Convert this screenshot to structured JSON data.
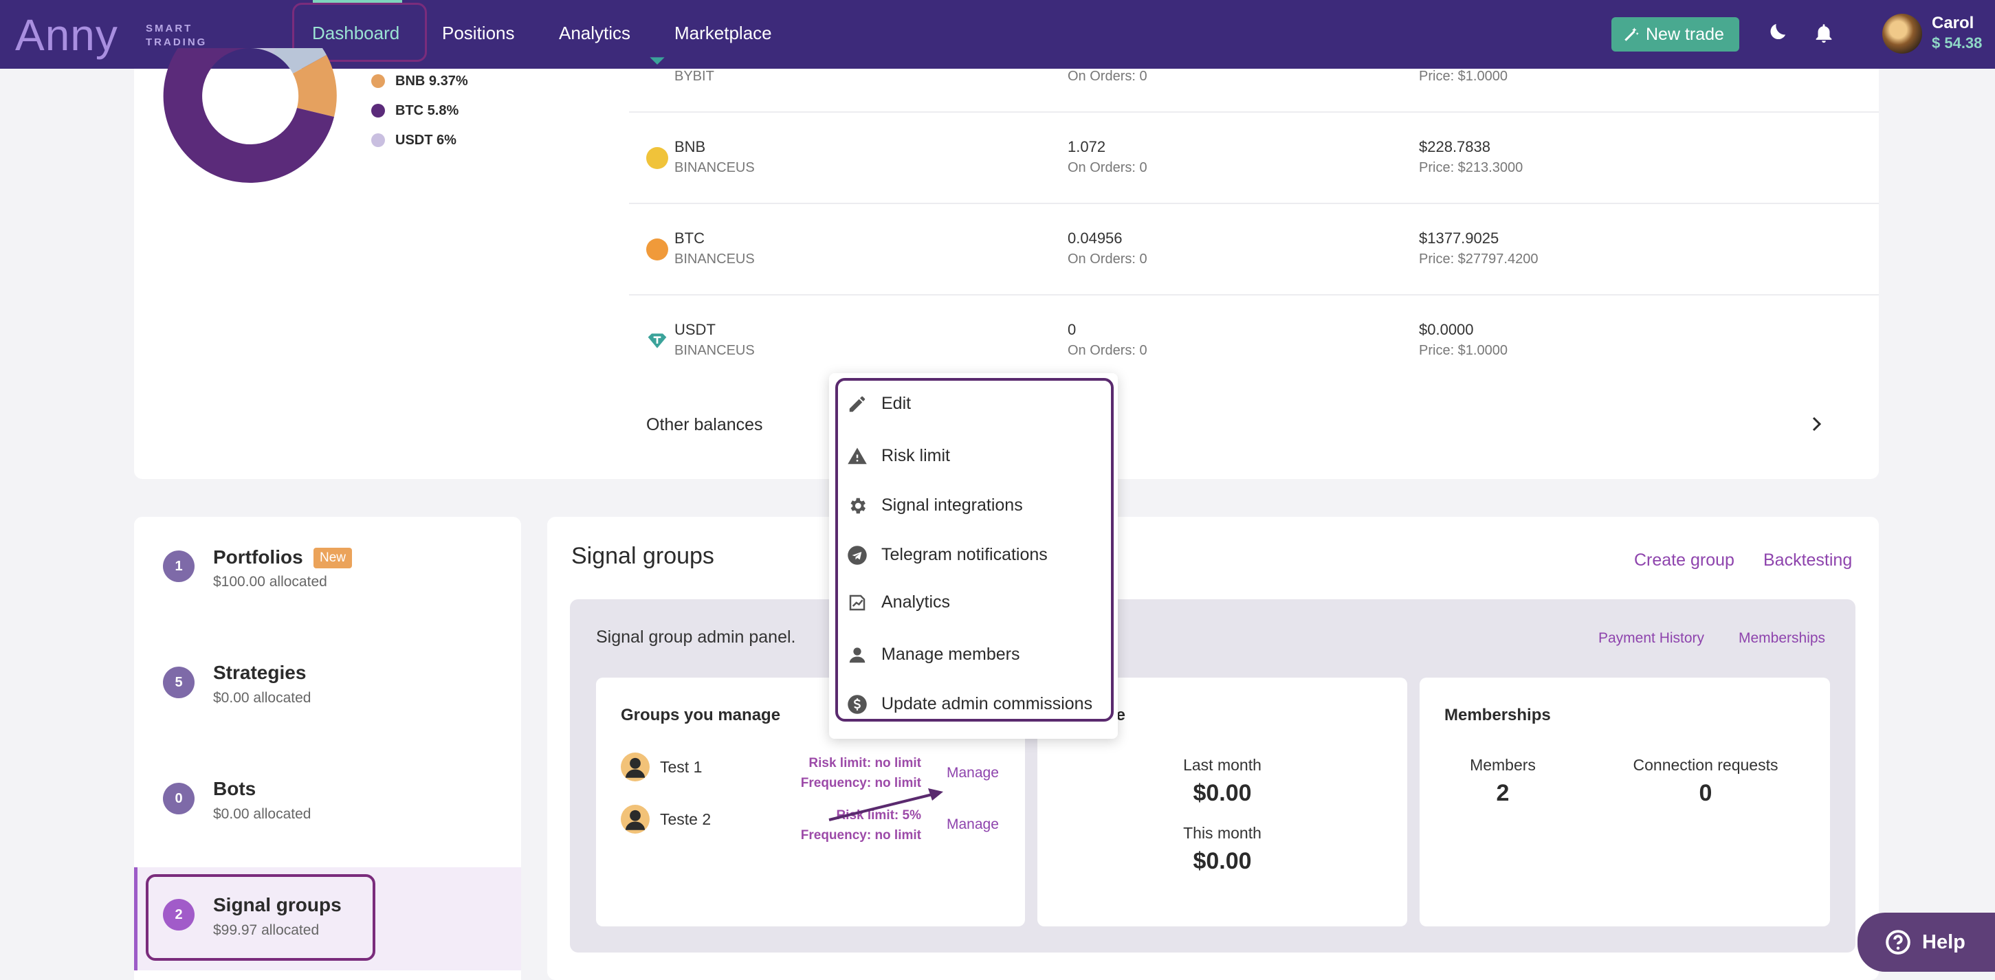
{
  "nav": {
    "logo_word": "Anny",
    "logo_sub_1": "SMART",
    "logo_sub_2": "TRADING",
    "items": [
      "Dashboard",
      "Positions",
      "Analytics",
      "Marketplace"
    ],
    "new_trade": "New trade",
    "user_name": "Carol",
    "user_balance": "$ 54.38"
  },
  "portfolio": {
    "legend": [
      {
        "label": "BNB 9.37%",
        "color": "#e5a15f"
      },
      {
        "label": "BTC 5.8%",
        "color": "#5b2b7a"
      },
      {
        "label": "USDT 6%",
        "color": "#c9bfe0"
      }
    ],
    "assets": [
      {
        "name": "",
        "exchange": "BYBIT",
        "amount": "",
        "on_orders": "On Orders: 0",
        "value": "",
        "price": "Price: $1.0000",
        "coin_color": "#3ba39a"
      },
      {
        "name": "BNB",
        "exchange": "BINANCEUS",
        "amount": "1.072",
        "on_orders": "On Orders: 0",
        "value": "$228.7838",
        "price": "Price: $213.3000",
        "coin_color": "#f0c33a"
      },
      {
        "name": "BTC",
        "exchange": "BINANCEUS",
        "amount": "0.04956",
        "on_orders": "On Orders: 0",
        "value": "$1377.9025",
        "price": "Price: $27797.4200",
        "coin_color": "#f09a3a"
      },
      {
        "name": "USDT",
        "exchange": "BINANCEUS",
        "amount": "0",
        "on_orders": "On Orders: 0",
        "value": "$0.0000",
        "price": "Price: $1.0000",
        "coin_color": "#3ba39a"
      }
    ],
    "other_balances": "Other balances"
  },
  "sidebar": {
    "items": [
      {
        "num": "1",
        "title": "Portfolios",
        "sub": "$100.00 allocated",
        "badge": "New"
      },
      {
        "num": "5",
        "title": "Strategies",
        "sub": "$0.00 allocated"
      },
      {
        "num": "0",
        "title": "Bots",
        "sub": "$0.00 allocated"
      },
      {
        "num": "2",
        "title": "Signal groups",
        "sub": "$99.97 allocated"
      }
    ]
  },
  "signal_groups": {
    "title": "Signal groups",
    "create_group": "Create group",
    "backtesting": "Backtesting",
    "panel_text": "Signal group admin panel.",
    "payment_history": "Payment History",
    "memberships_link": "Memberships",
    "groups_title": "Groups you manage",
    "groups": [
      {
        "name": "Test 1",
        "risk": "Risk limit: no limit",
        "freq": "Frequency: no limit",
        "manage": "Manage"
      },
      {
        "name": "Teste 2",
        "risk": "Risk limit: 5%",
        "freq": "Frequency: no limit",
        "manage": "Manage"
      }
    ],
    "revenue_title_partial": "ue",
    "last_month_label": "Last month",
    "last_month_value": "$0.00",
    "this_month_label": "This month",
    "this_month_value": "$0.00",
    "memberships_title": "Memberships",
    "members_label": "Members",
    "members_value": "2",
    "requests_label": "Connection requests",
    "requests_value": "0"
  },
  "menu": {
    "items": [
      {
        "label": "Edit",
        "icon": "pencil-icon"
      },
      {
        "label": "Risk limit",
        "icon": "warning-icon"
      },
      {
        "label": "Signal integrations",
        "icon": "gear-icon"
      },
      {
        "label": "Telegram notifications",
        "icon": "telegram-icon"
      },
      {
        "label": "Analytics",
        "icon": "analytics-icon"
      },
      {
        "label": "Manage members",
        "icon": "person-icon"
      },
      {
        "label": "Update admin commissions",
        "icon": "dollar-icon"
      }
    ]
  },
  "help": {
    "label": "Help"
  }
}
